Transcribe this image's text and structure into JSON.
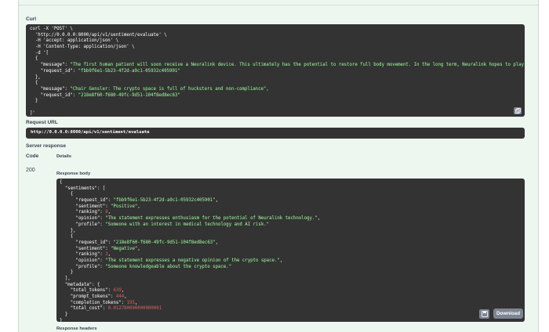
{
  "curl": {
    "label": "Curl",
    "lines": [
      "curl -X 'POST' \\",
      "  'http://0.0.0.0:8000/api/v1/sentiment/evaluate' \\",
      "  -H 'accept: application/json' \\",
      "  -H 'Content-Type: application/json' \\",
      "  -d '[",
      "  {",
      "    \"message\": \"The first human patient will soon receive a Neuralink device. This ultimately has the potential to restore full body movement. In the long term, Neuralink hopes to play a role",
      "    \"request_id\": \"fbb9f6e1-5b23-4f2d-a9c1-05932c405901\"",
      "  },",
      "  {",
      "    \"message\": \"Chair Gensler: The crypto space is full of hucksters and non-compliance\",",
      "    \"request_id\": \"218e8f60-f680-49fc-9d51-104f8ed8ec63\"",
      "  }",
      "",
      "]'"
    ]
  },
  "request_url": {
    "label": "Request URL",
    "value": "http://0.0.0.0:8000/api/v1/sentiment/evaluate"
  },
  "server_response": {
    "label": "Server response",
    "col_code": "Code",
    "col_details": "Details",
    "status_code": "200",
    "body_label": "Response body",
    "headers_label": "Response headers",
    "download_label": "Download"
  },
  "response_body": {
    "lines": [
      [
        [
          "w",
          "{"
        ]
      ],
      [
        [
          "w",
          "  \"sentiments\": ["
        ]
      ],
      [
        [
          "w",
          "    {"
        ]
      ],
      [
        [
          "w",
          "      \"request_id\": "
        ],
        [
          "s",
          "\"fbb9f6e1-5b23-4f2d-a9c1-05932c405901\""
        ],
        [
          "w",
          ","
        ]
      ],
      [
        [
          "w",
          "      \"sentiment\": "
        ],
        [
          "s",
          "\"Positive\""
        ],
        [
          "w",
          ","
        ]
      ],
      [
        [
          "w",
          "      \"ranking\": "
        ],
        [
          "n",
          "8"
        ],
        [
          "w",
          ","
        ]
      ],
      [
        [
          "w",
          "      \"opinion\": "
        ],
        [
          "s",
          "\"The statement expresses enthusiasm for the potential of Neuralink technology.\""
        ],
        [
          "w",
          ","
        ]
      ],
      [
        [
          "w",
          "      \"profile\": "
        ],
        [
          "s",
          "\"Someone with an interest in medical technology and AI risk.\""
        ]
      ],
      [
        [
          "w",
          "    },"
        ]
      ],
      [
        [
          "w",
          "    {"
        ]
      ],
      [
        [
          "w",
          "      \"request_id\": "
        ],
        [
          "s",
          "\"218e8f60-f680-49fc-9d51-104f8ed8ec63\""
        ],
        [
          "w",
          ","
        ]
      ],
      [
        [
          "w",
          "      \"sentiment\": "
        ],
        [
          "s",
          "\"Negative\""
        ],
        [
          "w",
          ","
        ]
      ],
      [
        [
          "w",
          "      \"ranking\": "
        ],
        [
          "n",
          "3"
        ],
        [
          "w",
          ","
        ]
      ],
      [
        [
          "w",
          "      \"opinion\": "
        ],
        [
          "s",
          "\"The statement expresses a negative opinion of the crypto space.\""
        ],
        [
          "w",
          ","
        ]
      ],
      [
        [
          "w",
          "      \"profile\": "
        ],
        [
          "s",
          "\"Someone knowledgeable about the crypto space.\""
        ]
      ],
      [
        [
          "w",
          "    }"
        ]
      ],
      [
        [
          "w",
          "  ],"
        ]
      ],
      [
        [
          "w",
          "  \"metadata\": {"
        ]
      ],
      [
        [
          "w",
          "    \"total_tokens\": "
        ],
        [
          "n",
          "639"
        ],
        [
          "w",
          ","
        ]
      ],
      [
        [
          "w",
          "    \"prompt_tokens\": "
        ],
        [
          "n",
          "444"
        ],
        [
          "w",
          ","
        ]
      ],
      [
        [
          "w",
          "    \"completion_tokens\": "
        ],
        [
          "n",
          "195"
        ],
        [
          "w",
          ","
        ]
      ],
      [
        [
          "w",
          "    \"total_cost\": "
        ],
        [
          "n",
          "0.012780000000000001"
        ]
      ],
      [
        [
          "w",
          "  }"
        ]
      ],
      [
        [
          "w",
          "}"
        ]
      ]
    ]
  },
  "icons": {
    "copy": "copy-icon",
    "save": "save-icon"
  },
  "colors": {
    "panel_bg": "#eef6f0",
    "code_bg": "#333333",
    "string": "#a2fca2",
    "number": "#d36363",
    "button": "#7d8492"
  }
}
